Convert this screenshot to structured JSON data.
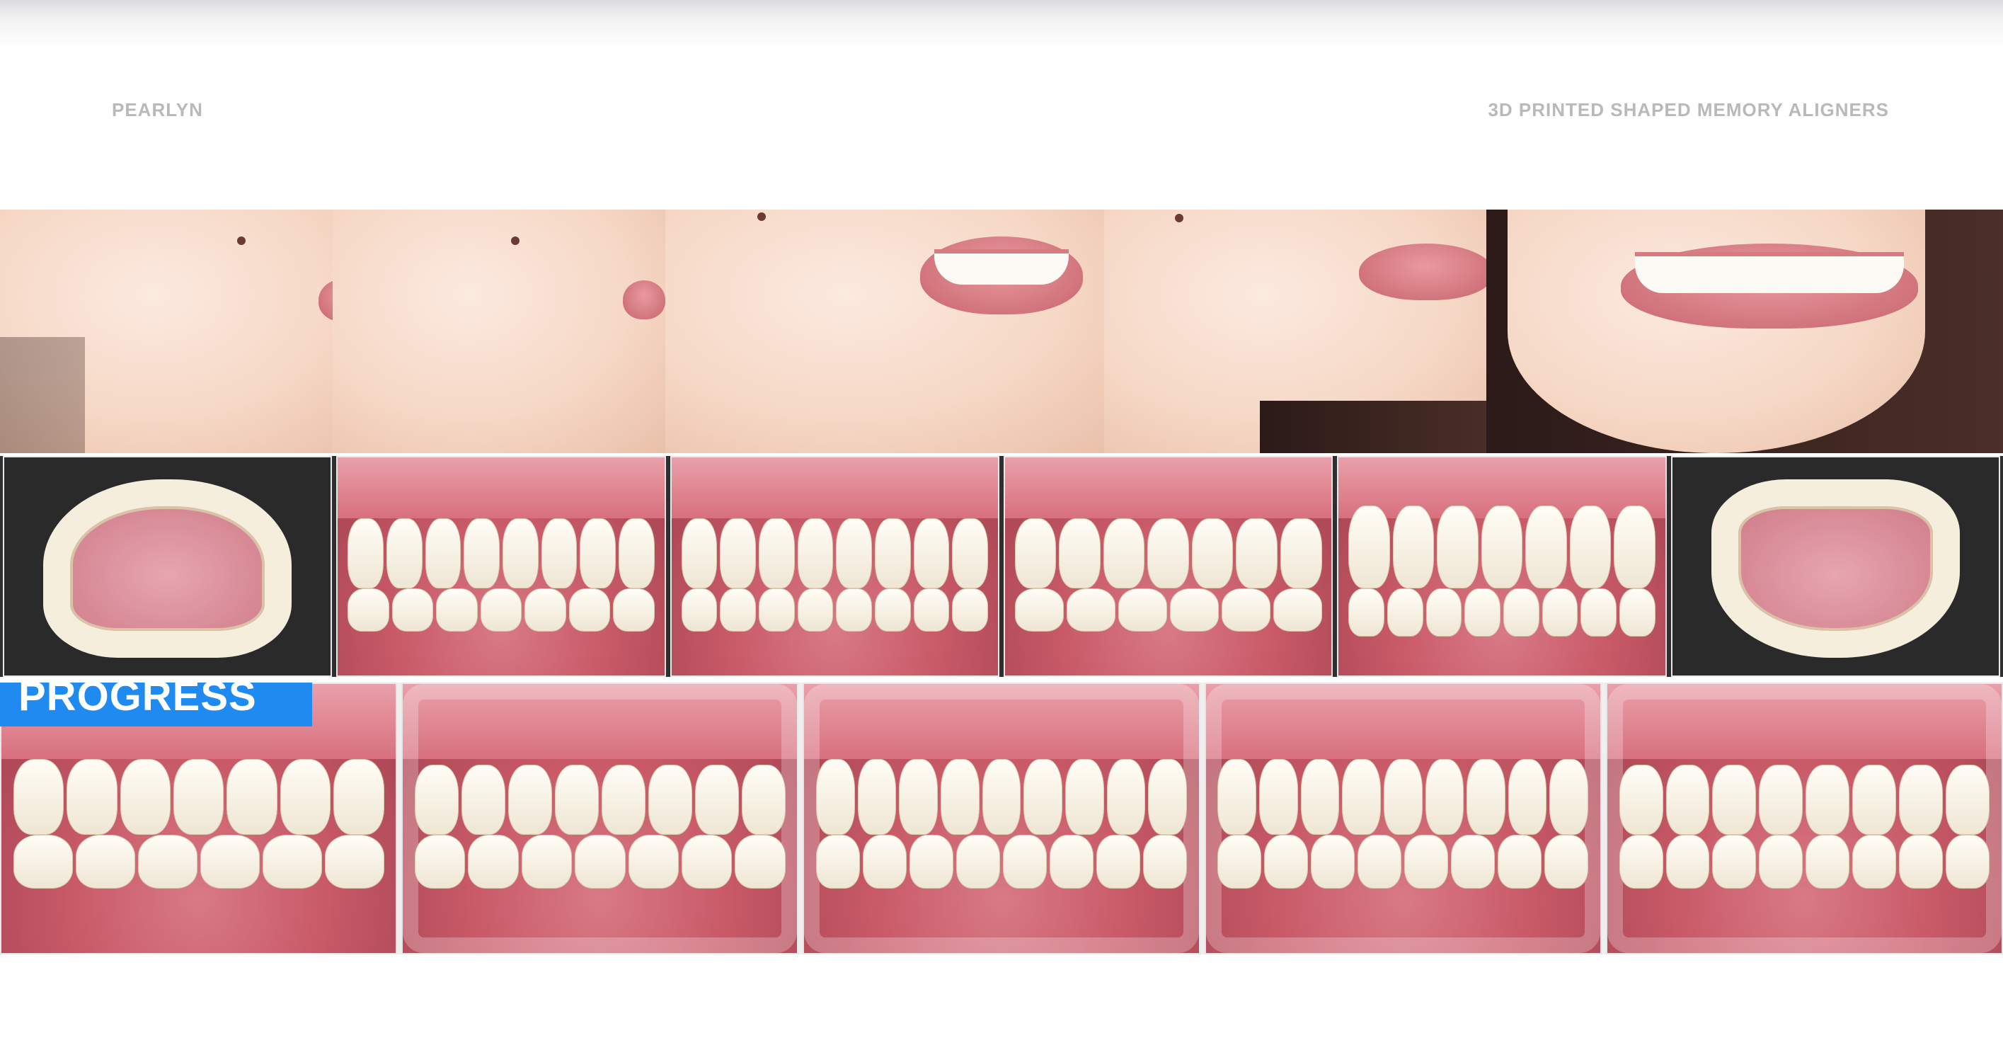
{
  "header": {
    "brand": "PEARLYN",
    "tagline": "3D PRINTED SHAPED MEMORY ALIGNERS"
  },
  "faces": [
    {
      "view": "profile"
    },
    {
      "view": "profile-closed"
    },
    {
      "view": "three-quarter-smile"
    },
    {
      "view": "three-quarter-closed"
    },
    {
      "view": "frontal-smile"
    }
  ],
  "intraoral_row": [
    {
      "view": "upper-occlusal"
    },
    {
      "view": "right-buccal"
    },
    {
      "view": "frontal"
    },
    {
      "view": "left-buccal"
    },
    {
      "view": "frontal-close"
    },
    {
      "view": "lower-occlusal"
    }
  ],
  "progress": {
    "label": "PROGRESS",
    "stages": 5
  },
  "colors": {
    "progress_tag": "#1f8bf0",
    "header_text": "#b9b9bc",
    "gum": "#c95a68",
    "tooth": "#fbfaf4"
  }
}
